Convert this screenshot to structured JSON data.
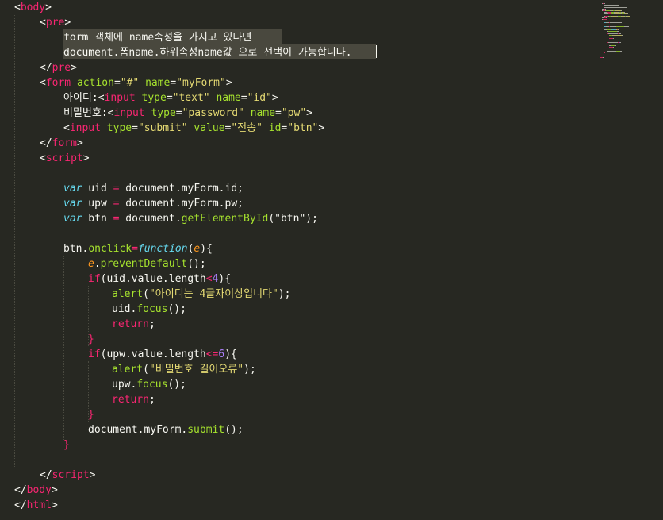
{
  "editor": {
    "theme_colors": {
      "background": "#272822",
      "text": "#F8F8F2",
      "tag": "#F92672",
      "attribute": "#A6E22E",
      "string": "#E6DB74",
      "keyword": "#66D9EF",
      "number": "#AE81FF",
      "selection": "#49483E"
    },
    "lines": [
      [
        [
          "p",
          "<"
        ],
        [
          "t",
          "body"
        ],
        [
          "p",
          ">"
        ]
      ],
      [
        [
          "p",
          "<"
        ],
        [
          "t",
          "pre"
        ],
        [
          "p",
          ">"
        ]
      ],
      [
        [
          "p",
          "form 객체에 name속성을 가지고 있다면"
        ]
      ],
      [
        [
          "p",
          "document.폼name.하위속성name값 으로 선택이 가능합니다."
        ]
      ],
      [
        [
          "p",
          "</"
        ],
        [
          "t",
          "pre"
        ],
        [
          "p",
          ">"
        ]
      ],
      [
        [
          "p",
          "<"
        ],
        [
          "t",
          "form"
        ],
        [
          "p",
          " "
        ],
        [
          "a",
          "action"
        ],
        [
          "p",
          "="
        ],
        [
          "s",
          "\"#\""
        ],
        [
          "p",
          " "
        ],
        [
          "a",
          "name"
        ],
        [
          "p",
          "="
        ],
        [
          "s",
          "\"myForm\""
        ],
        [
          "p",
          ">"
        ]
      ],
      [
        [
          "p",
          "아이디:<"
        ],
        [
          "t",
          "input"
        ],
        [
          "p",
          " "
        ],
        [
          "a",
          "type"
        ],
        [
          "p",
          "="
        ],
        [
          "s",
          "\"text\""
        ],
        [
          "p",
          " "
        ],
        [
          "a",
          "name"
        ],
        [
          "p",
          "="
        ],
        [
          "s",
          "\"id\""
        ],
        [
          "p",
          ">"
        ]
      ],
      [
        [
          "p",
          "비밀번호:<"
        ],
        [
          "t",
          "input"
        ],
        [
          "p",
          " "
        ],
        [
          "a",
          "type"
        ],
        [
          "p",
          "="
        ],
        [
          "s",
          "\"password\""
        ],
        [
          "p",
          " "
        ],
        [
          "a",
          "name"
        ],
        [
          "p",
          "="
        ],
        [
          "s",
          "\"pw\""
        ],
        [
          "p",
          ">"
        ]
      ],
      [
        [
          "p",
          "<"
        ],
        [
          "t",
          "input"
        ],
        [
          "p",
          " "
        ],
        [
          "a",
          "type"
        ],
        [
          "p",
          "="
        ],
        [
          "s",
          "\"submit\""
        ],
        [
          "p",
          " "
        ],
        [
          "a",
          "value"
        ],
        [
          "p",
          "="
        ],
        [
          "s",
          "\"전송\""
        ],
        [
          "p",
          " "
        ],
        [
          "a",
          "id"
        ],
        [
          "p",
          "="
        ],
        [
          "s",
          "\"btn\""
        ],
        [
          "p",
          ">"
        ]
      ],
      [
        [
          "p",
          "</"
        ],
        [
          "t",
          "form"
        ],
        [
          "p",
          ">"
        ]
      ],
      [
        [
          "p",
          "<"
        ],
        [
          "t",
          "script"
        ],
        [
          "p",
          ">"
        ]
      ],
      [],
      [
        [
          "k",
          "var"
        ],
        [
          "p",
          " uid "
        ],
        [
          "o",
          "="
        ],
        [
          "p",
          " document.myForm.id;"
        ]
      ],
      [
        [
          "k",
          "var"
        ],
        [
          "p",
          " upw "
        ],
        [
          "o",
          "="
        ],
        [
          "p",
          " document.myForm.pw;"
        ]
      ],
      [
        [
          "k",
          "var"
        ],
        [
          "p",
          " btn "
        ],
        [
          "o",
          "="
        ],
        [
          "p",
          " document."
        ],
        [
          "f",
          "getElementById"
        ],
        [
          "p",
          "(\"btn\");"
        ]
      ],
      [],
      [
        [
          "p",
          "btn."
        ],
        [
          "f",
          "onclick"
        ],
        [
          "o",
          "="
        ],
        [
          "k",
          "function"
        ],
        [
          "p",
          "("
        ],
        [
          "v",
          "e"
        ],
        [
          "p",
          "){"
        ]
      ],
      [
        [
          "v",
          "e"
        ],
        [
          "p",
          "."
        ],
        [
          "f",
          "preventDefault"
        ],
        [
          "p",
          "();"
        ]
      ],
      [
        [
          "kw",
          "if"
        ],
        [
          "p",
          "(uid.value.length"
        ],
        [
          "o",
          "<"
        ],
        [
          "n",
          "4"
        ],
        [
          "p",
          "){"
        ]
      ],
      [
        [
          "f",
          "alert"
        ],
        [
          "p",
          "("
        ],
        [
          "s",
          "\"아이디는 4글자이상입니다\""
        ],
        [
          "p",
          ");"
        ]
      ],
      [
        [
          "p",
          "uid."
        ],
        [
          "f",
          "focus"
        ],
        [
          "p",
          "();"
        ]
      ],
      [
        [
          "kw",
          "return"
        ],
        [
          "p",
          ";"
        ]
      ],
      [
        [
          "kw",
          "}"
        ]
      ],
      [
        [
          "kw",
          "if"
        ],
        [
          "p",
          "(upw.value.length"
        ],
        [
          "o",
          "<="
        ],
        [
          "n",
          "6"
        ],
        [
          "p",
          "){"
        ]
      ],
      [
        [
          "f",
          "alert"
        ],
        [
          "p",
          "("
        ],
        [
          "s",
          "\"비밀번호 길이오류\""
        ],
        [
          "p",
          ");"
        ]
      ],
      [
        [
          "p",
          "upw."
        ],
        [
          "f",
          "focus"
        ],
        [
          "p",
          "();"
        ]
      ],
      [
        [
          "kw",
          "return"
        ],
        [
          "p",
          ";"
        ]
      ],
      [
        [
          "kw",
          "}"
        ]
      ],
      [
        [
          "p",
          "document.myForm."
        ],
        [
          "f",
          "submit"
        ],
        [
          "p",
          "();"
        ]
      ],
      [
        [
          "kw",
          "}"
        ]
      ],
      [],
      [
        [
          "p",
          "</"
        ],
        [
          "t",
          "script"
        ],
        [
          "p",
          ">"
        ]
      ],
      [
        [
          "p",
          "</"
        ],
        [
          "t",
          "body"
        ],
        [
          "p",
          ">"
        ]
      ],
      [
        [
          "p",
          "</"
        ],
        [
          "t",
          "html"
        ],
        [
          "p",
          ">"
        ]
      ]
    ]
  }
}
